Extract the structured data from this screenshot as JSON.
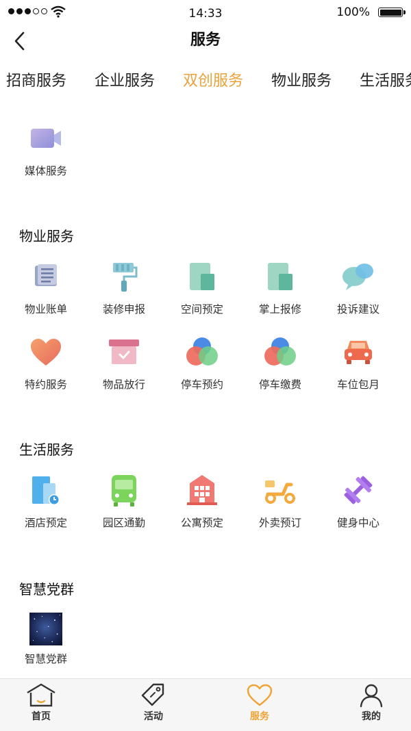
{
  "status_bar": {
    "time": "14:33",
    "battery": "100%"
  },
  "header": {
    "title": "服务"
  },
  "tabs": [
    {
      "label": "招商服务"
    },
    {
      "label": "企业服务"
    },
    {
      "label": "双创服务",
      "active": true
    },
    {
      "label": "物业服务"
    },
    {
      "label": "生活服务"
    }
  ],
  "sections": {
    "shuangchuang": {
      "items": [
        {
          "label": "媒体服务",
          "icon": "video-camera-icon"
        }
      ]
    },
    "property": {
      "title": "物业服务",
      "items": [
        {
          "label": "物业账单",
          "icon": "document-list-icon"
        },
        {
          "label": "装修申报",
          "icon": "paint-roller-icon"
        },
        {
          "label": "空间预定",
          "icon": "space-door-icon"
        },
        {
          "label": "掌上报修",
          "icon": "repair-panel-icon"
        },
        {
          "label": "投诉建议",
          "icon": "chat-bubble-icon"
        },
        {
          "label": "特约服务",
          "icon": "heart-icon"
        },
        {
          "label": "物品放行",
          "icon": "box-check-icon"
        },
        {
          "label": "停车预约",
          "icon": "color-circles-icon"
        },
        {
          "label": "停车缴费",
          "icon": "color-circles-icon"
        },
        {
          "label": "车位包月",
          "icon": "car-icon"
        }
      ]
    },
    "life": {
      "title": "生活服务",
      "items": [
        {
          "label": "酒店预定",
          "icon": "hotel-clock-icon"
        },
        {
          "label": "园区通勤",
          "icon": "bus-icon"
        },
        {
          "label": "公寓预定",
          "icon": "apartment-building-icon"
        },
        {
          "label": "外卖预订",
          "icon": "scooter-icon"
        },
        {
          "label": "健身中心",
          "icon": "dumbbell-icon"
        }
      ]
    },
    "party": {
      "title": "智慧党群",
      "items": [
        {
          "label": "智慧党群",
          "icon": "starfield-image"
        }
      ]
    }
  },
  "tab_bar": [
    {
      "label": "首页",
      "icon": "home-icon"
    },
    {
      "label": "活动",
      "icon": "tag-icon"
    },
    {
      "label": "服务",
      "icon": "heart-outline-icon",
      "active": true
    },
    {
      "label": "我的",
      "icon": "person-icon"
    }
  ],
  "colors": {
    "accent": "#E8A33C",
    "tab_active": "#F0A332"
  }
}
